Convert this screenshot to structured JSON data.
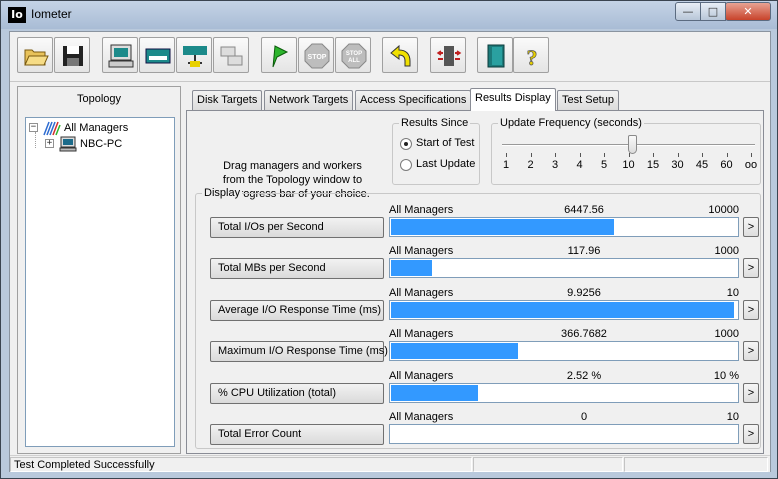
{
  "window": {
    "title": "Iometer",
    "app_icon_text": "Io",
    "controls": {
      "minimize": "—",
      "maximize": "□",
      "close": "✕"
    }
  },
  "toolbar": {
    "buttons": [
      {
        "name": "open-config-button",
        "icon": "open-folder-icon"
      },
      {
        "name": "save-config-button",
        "icon": "floppy-disk-icon"
      },
      {
        "name": "start-disk-worker-button",
        "icon": "disk-worker-icon"
      },
      {
        "name": "start-network-worker-button",
        "icon": "network-worker-icon"
      },
      {
        "name": "duplicate-worker-button",
        "icon": "duplicate-worker-icon"
      },
      {
        "name": "disconnect-button",
        "icon": "disconnect-icon"
      },
      {
        "name": "start-tests-button",
        "icon": "green-flag-icon"
      },
      {
        "name": "stop-button",
        "icon": "stop-sign-icon",
        "label": "STOP"
      },
      {
        "name": "stop-all-button",
        "icon": "stop-all-sign-icon",
        "label": "STOP\nALL"
      },
      {
        "name": "reset-workers-button",
        "icon": "reset-arrow-icon"
      },
      {
        "name": "exit-iometer-button",
        "icon": "exit-door-icon"
      },
      {
        "name": "about-button",
        "icon": "question-mark-icon",
        "label": "?"
      }
    ]
  },
  "topology": {
    "title": "Topology",
    "root": {
      "label": "All Managers",
      "expander": "−"
    },
    "children": [
      {
        "label": "NBC-PC",
        "expander": "+"
      }
    ]
  },
  "tabs": [
    {
      "label": "Disk Targets",
      "active": false
    },
    {
      "label": "Network Targets",
      "active": false
    },
    {
      "label": "Access Specifications",
      "active": false
    },
    {
      "label": "Results Display",
      "active": true
    },
    {
      "label": "Test Setup",
      "active": false
    }
  ],
  "results_display": {
    "hint": "Drag managers and workers from the Topology window to the progress bar of your choice.",
    "results_since": {
      "title": "Results Since",
      "options": [
        {
          "label": "Start of Test",
          "selected": true
        },
        {
          "label": "Last Update",
          "selected": false
        }
      ]
    },
    "update_frequency": {
      "title": "Update Frequency (seconds)",
      "ticks": [
        "1",
        "2",
        "3",
        "4",
        "5",
        "10",
        "15",
        "30",
        "45",
        "60",
        "oo"
      ],
      "selected": "10"
    },
    "display": {
      "title": "Display",
      "arrow_label": ">",
      "metrics": [
        {
          "button": "Total I/Os per Second",
          "source": "All Managers",
          "value": "6447.56",
          "max": "10000",
          "fraction": 0.6448
        },
        {
          "button": "Total MBs per Second",
          "source": "All Managers",
          "value": "117.96",
          "max": "1000",
          "fraction": 0.118
        },
        {
          "button": "Average I/O Response Time (ms)",
          "source": "All Managers",
          "value": "9.9256",
          "max": "10",
          "fraction": 0.9926
        },
        {
          "button": "Maximum I/O Response Time (ms)",
          "source": "All Managers",
          "value": "366.7682",
          "max": "1000",
          "fraction": 0.3668
        },
        {
          "button": "% CPU Utilization (total)",
          "source": "All Managers",
          "value": "2.52 %",
          "max": "10 %",
          "fraction": 0.252
        },
        {
          "button": "Total Error Count",
          "source": "All Managers",
          "value": "0",
          "max": "10",
          "fraction": 0
        }
      ]
    }
  },
  "status_bar": {
    "text": "Test Completed Successfully"
  },
  "colors": {
    "bar_fill": "#3399ff",
    "title_bar": "#b9c9dc",
    "close_button": "#c8432b"
  }
}
